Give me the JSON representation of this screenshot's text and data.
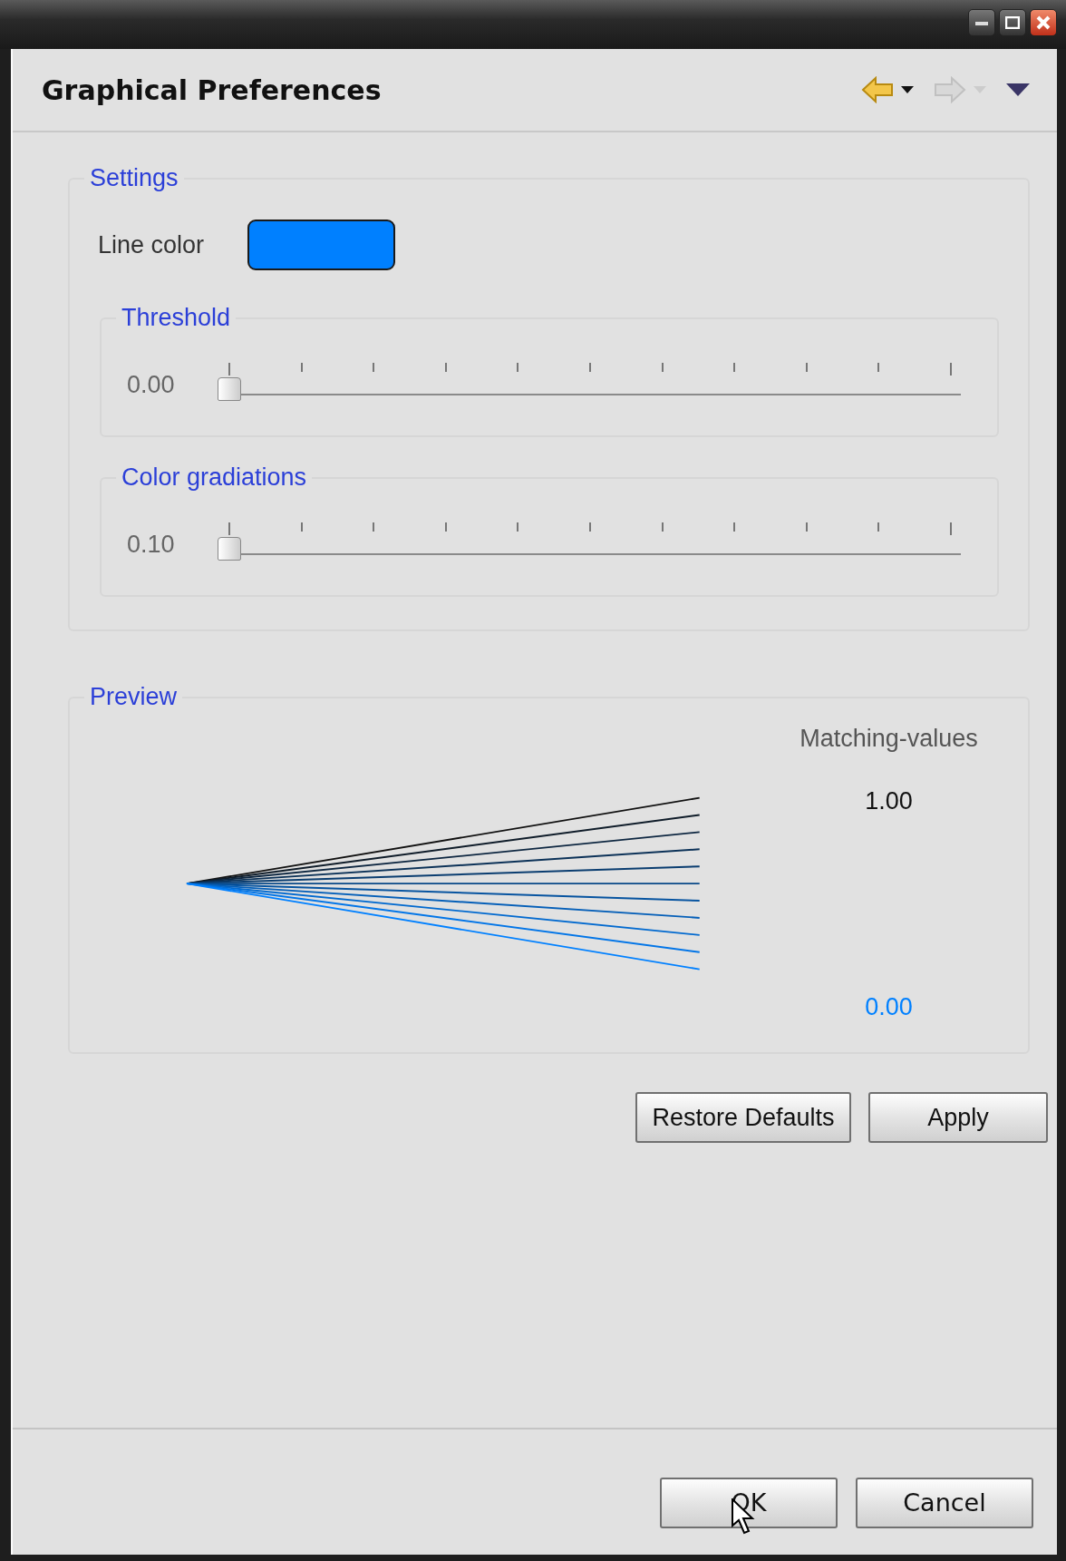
{
  "page": {
    "title": "Graphical Preferences"
  },
  "navigation": [
    {
      "kind": "back",
      "disabled": false
    },
    {
      "kind": "forward",
      "disabled": true
    }
  ],
  "settings": {
    "legend": "Settings",
    "line_color_label": "Line color",
    "color": "#0080ff",
    "sliders": [
      {
        "legend": "Threshold",
        "reading": "0.00",
        "level": 0
      },
      {
        "legend": "Color gradiations",
        "reading": "0.10",
        "level": 0
      }
    ]
  },
  "preview": {
    "legend": "Preview",
    "axis_label": "Matching-values",
    "top_value": "1.00",
    "bottom_value": "0.00"
  },
  "page_buttons": [
    "Restore Defaults",
    "Apply"
  ],
  "dialog_buttons": [
    "OK",
    "Cancel"
  ]
}
